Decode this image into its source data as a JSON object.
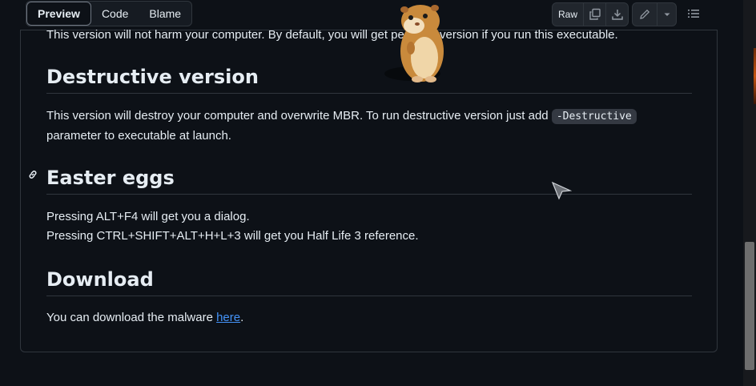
{
  "toolbar": {
    "tabs": [
      "Preview",
      "Code",
      "Blame"
    ],
    "raw_label": "Raw"
  },
  "content": {
    "intro_fragment": "This version will not harm your computer. By default, you will get peaceful version if you run this executable.",
    "sections": [
      {
        "heading": "Destructive version",
        "text_before_code": "This version will destroy your computer and overwrite MBR. To run destructive version just add ",
        "code": "-Destructive",
        "text_after_code": "parameter to executable at launch."
      },
      {
        "heading": "Easter eggs",
        "lines": [
          "Pressing ALT+F4 will get you a dialog.",
          "Pressing CTRL+SHIFT+ALT+H+L+3 will get you Half Life 3 reference."
        ]
      },
      {
        "heading": "Download",
        "text_before_link": "You can download the malware ",
        "link_text": "here",
        "text_after_link": "."
      }
    ]
  },
  "icons": {
    "copy": "copy-icon",
    "download": "download-icon",
    "edit": "pencil-icon",
    "dropdown": "chevron-down-icon",
    "outline": "list-icon",
    "anchor": "link-icon",
    "cursor": "arrow-cursor-icon",
    "overlay": "hamster-image"
  },
  "colors": {
    "background": "#0d1117",
    "border": "#30363d",
    "link": "#4493f8",
    "text": "#e6edf3"
  }
}
